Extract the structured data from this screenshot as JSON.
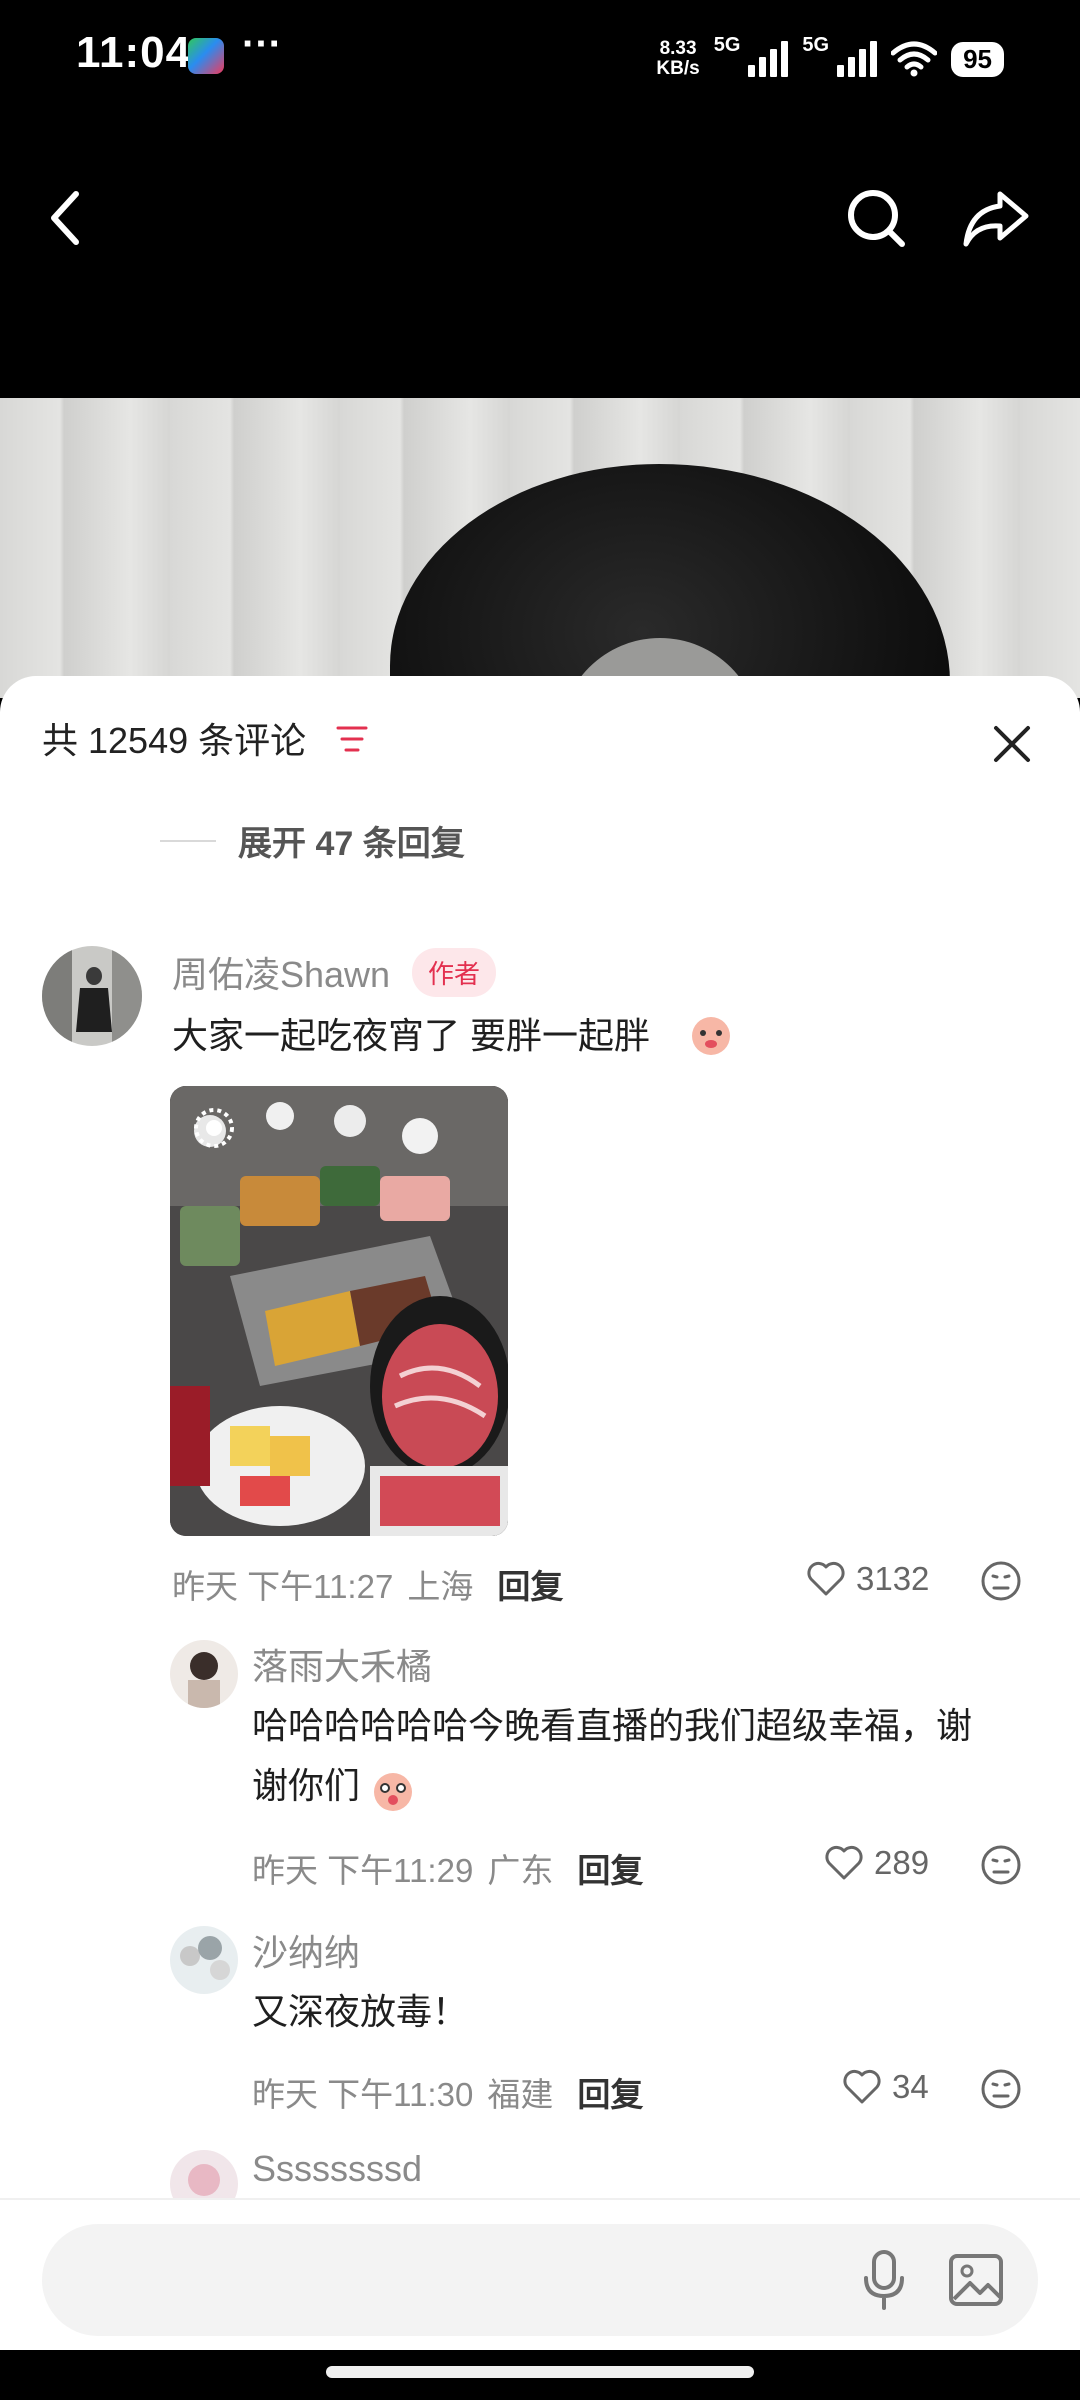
{
  "status_bar": {
    "time": "11:04",
    "more": "···",
    "net_speed_value": "8.33",
    "net_speed_unit": "KB/s",
    "sim1": "5G",
    "sim2": "5G",
    "wifi_label": "6",
    "battery": "95"
  },
  "header": {
    "back_icon": "chevron-left-icon",
    "search_icon": "search-icon",
    "share_icon": "share-icon"
  },
  "comments_panel": {
    "title": "共 12549 条评论",
    "expand_replies": "展开 47 条回复",
    "comments": [
      {
        "name": "周佑凌Shawn",
        "tag": "作者",
        "text": "大家一起吃夜宵了 要胖一起胖",
        "time": "昨天 下午11:27",
        "location": "上海",
        "reply_label": "回复",
        "likes": "3132"
      }
    ],
    "replies": [
      {
        "name": "落雨大禾橘",
        "text_line1": "哈哈哈哈哈哈今晚看直播的我们超级幸福，谢",
        "text_line2": "谢你们",
        "time": "昨天 下午11:29",
        "location": "广东",
        "reply_label": "回复",
        "likes": "289"
      },
      {
        "name": "沙纳纳",
        "text": "又深夜放毒！",
        "time": "昨天 下午11:30",
        "location": "福建",
        "reply_label": "回复",
        "likes": "34"
      },
      {
        "name": "Ssssssssd"
      }
    ]
  },
  "bottom_bar": {
    "placeholder": "",
    "mic_icon": "mic-icon",
    "image_icon": "image-icon"
  },
  "colors": {
    "accent_pink": "#e3304f",
    "author_tag_bg": "#fde7ea",
    "text_gray": "#8a8a8a"
  }
}
